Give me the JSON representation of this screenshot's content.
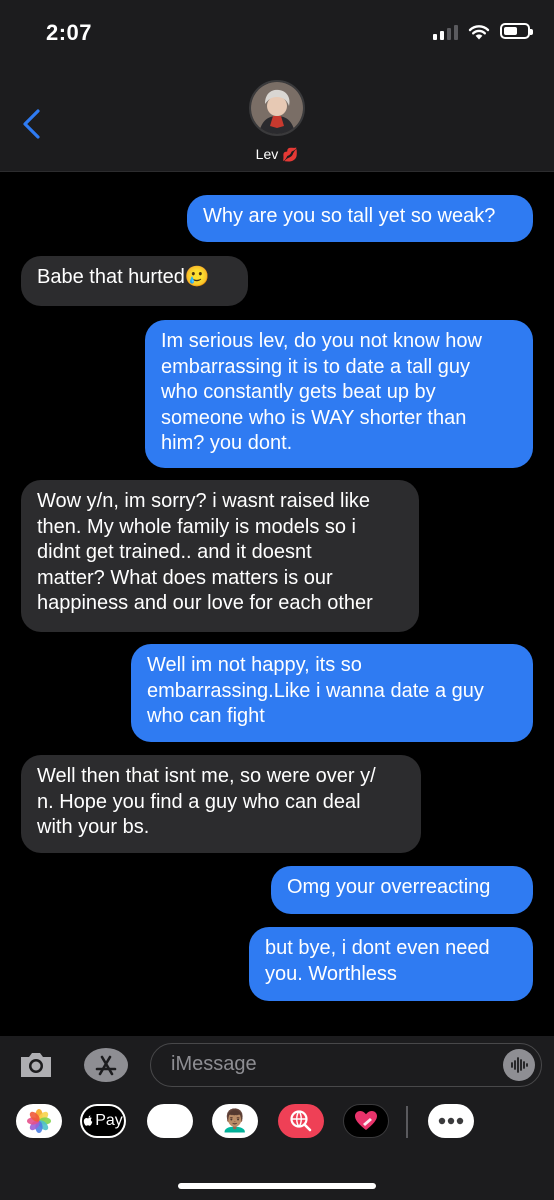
{
  "status_bar": {
    "time": "2:07"
  },
  "header": {
    "contact_name": "Lev",
    "name_emoji": "💋"
  },
  "messages": [
    {
      "side": "sent",
      "text": "Why are you so tall yet so weak?"
    },
    {
      "side": "received",
      "text": "Babe that hurted🥲"
    },
    {
      "side": "sent",
      "text": "Im serious lev, do you not know how\nembarrassing it is to date a tall guy\nwho constantly gets beat up by\nsomeone who is WAY shorter than\nhim? you dont."
    },
    {
      "side": "received",
      "text": "Wow y/n, im sorry? i wasnt raised like\nthen. My whole family is models so i\ndidnt get trained.. and it doesnt\nmatter? What does matters is our\nhappiness and our love for each other"
    },
    {
      "side": "sent",
      "text": "Well im not happy, its so\nembarrassing.Like i wanna date a guy\nwho can fight"
    },
    {
      "side": "received",
      "text": "Well then that isnt me, so were over y/\nn. Hope you find a guy who can deal\nwith your bs."
    },
    {
      "side": "sent",
      "text": "Omg your overreacting"
    },
    {
      "side": "sent",
      "text": "but bye, i dont even need\nyou. Worthless"
    }
  ],
  "composer": {
    "placeholder": "iMessage"
  },
  "app_tray": [
    {
      "name": "photos-app",
      "icon": "photos-icon"
    },
    {
      "name": "apple-pay-app",
      "icon": "apple-pay-icon",
      "label": "Pay"
    },
    {
      "name": "animoji-app",
      "icon": "monkey-icon",
      "emoji": "🐵"
    },
    {
      "name": "memoji-app",
      "icon": "memoji-icon",
      "emoji": "👨🏽‍🦱"
    },
    {
      "name": "image-search-app",
      "icon": "globe-search-icon"
    },
    {
      "name": "digital-touch-app",
      "icon": "heart-touch-icon"
    },
    {
      "name": "more-apps",
      "icon": "more-icon"
    }
  ],
  "colors": {
    "sent_bubble": "#2f7bf2",
    "received_bubble": "#2c2c2e",
    "header_bg": "#1c1c1e",
    "accent": "#2f7bf2"
  }
}
